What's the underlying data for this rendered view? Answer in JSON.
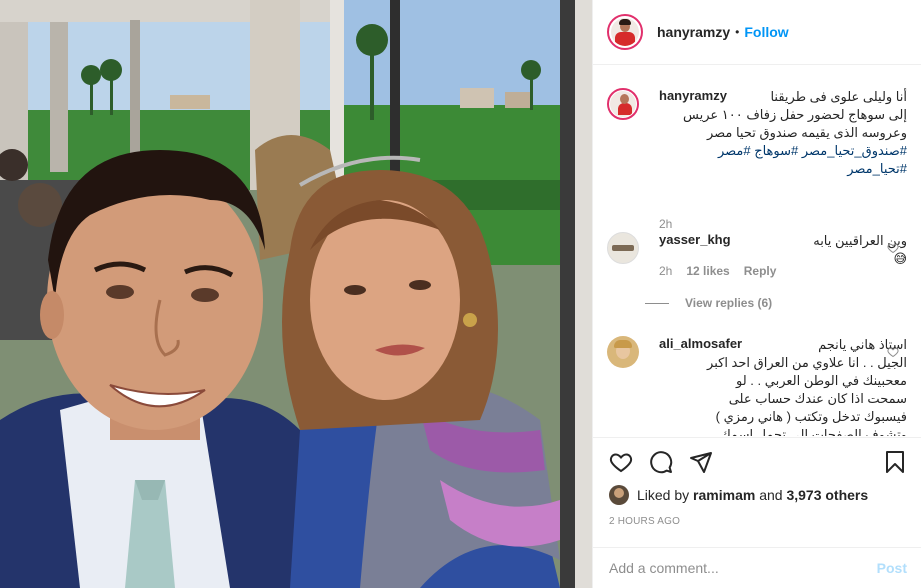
{
  "post": {
    "username": "hanyramzy",
    "follow_label": "Follow",
    "separator": "•"
  },
  "caption": {
    "username": "hanyramzy",
    "lines": [
      "أنا وليلى علوى فى طريقنا",
      "إلى سوهاج لحضور حفل زفاف ١٠٠ عريس",
      "وعروسه الذى يقيمه صندوق تحيا مصر"
    ],
    "hashtags_line1": "#صندوق_تحيا_مصر #سوهاج #مصر",
    "hashtags_line2": "#تحيا_مصر",
    "time": "2h"
  },
  "comments": [
    {
      "username": "yasser_khg",
      "text": "وين العراقيين يابه😅",
      "time": "2h",
      "likes": "12 likes",
      "reply_label": "Reply",
      "view_replies": "View replies (6)"
    },
    {
      "username": "ali_almosafer",
      "lines": [
        "استاذ هاني يانجم",
        "الجيل . . انا علاوي من العراق احد اكبر",
        "معحبينك في الوطن العربي . . لو",
        "سمحت اذا كان عندك حساب على",
        "فيسبوك تدخل وتكتب ( هاني رمزي )",
        "وتشوف الصفحات الي تحمل اسمك"
      ]
    }
  ],
  "actions": {
    "liked_by_prefix": "Liked by",
    "liked_by_user": "ramimam",
    "and": "and",
    "others": "3,973 others",
    "timestamp": "2 HOURS AGO"
  },
  "add_comment": {
    "placeholder": "Add a comment...",
    "post_label": "Post"
  },
  "colors": {
    "accent": "#0095f6",
    "story_ring": "#e1306c",
    "hashtag": "#00376b",
    "muted": "#8e8e8e"
  },
  "icons": [
    "heart-icon",
    "comment-icon",
    "share-icon",
    "bookmark-icon",
    "like-small-icon"
  ]
}
